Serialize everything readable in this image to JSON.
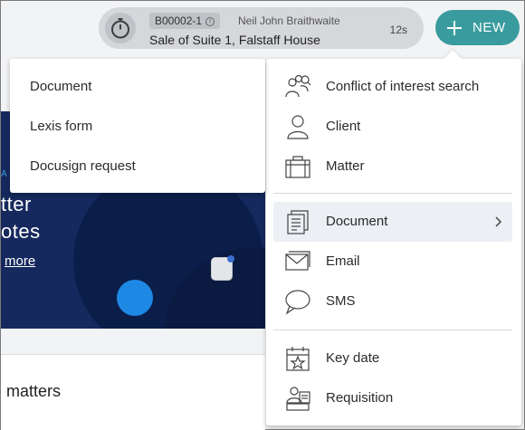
{
  "matter_bar": {
    "code": "B00002-1",
    "client": "Neil John Braithwaite",
    "name": "Sale of Suite 1, Falstaff House",
    "elapsed": "12s"
  },
  "new_button": {
    "label": "NEW"
  },
  "new_menu": {
    "items": [
      {
        "label": "Conflict of interest search",
        "icon": "people-search-icon"
      },
      {
        "label": "Client",
        "icon": "person-icon"
      },
      {
        "label": "Matter",
        "icon": "briefcase-icon"
      },
      {
        "label": "Document",
        "icon": "documents-icon",
        "has_submenu": true
      },
      {
        "label": "Email",
        "icon": "envelope-icon"
      },
      {
        "label": "SMS",
        "icon": "chat-bubble-icon"
      },
      {
        "label": "Key date",
        "icon": "calendar-star-icon"
      },
      {
        "label": "Requisition",
        "icon": "requisition-icon"
      }
    ]
  },
  "document_submenu": {
    "items": [
      {
        "label": "Document"
      },
      {
        "label": "Lexis form"
      },
      {
        "label": "Docusign request"
      }
    ]
  },
  "background": {
    "hero_text": [
      "tter",
      "otes"
    ],
    "hero_link": "more",
    "section_title": "matters"
  },
  "colors": {
    "accent": "#3a9b9e",
    "hero_bg": "#16295e",
    "menu_active_bg": "#eceff4"
  }
}
